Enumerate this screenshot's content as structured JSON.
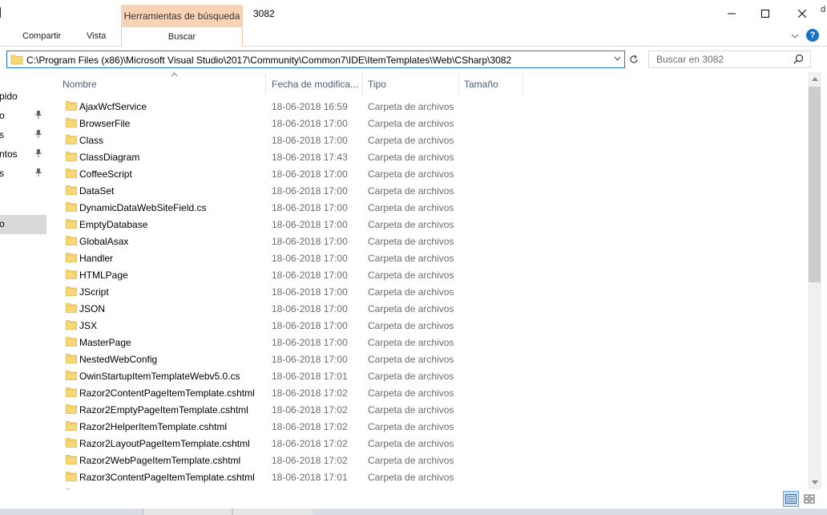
{
  "window": {
    "title": "3082",
    "contextual_tab_header": "Herramientas de búsqueda",
    "contextual_tab": "Buscar",
    "edge_letter": "d"
  },
  "ribbon": {
    "tabs": [
      {
        "label": "Compartir"
      },
      {
        "label": "Vista"
      }
    ],
    "expand_icon": "chevron-down-icon",
    "help_icon": "help-icon"
  },
  "address": {
    "path": "C:\\Program Files (x86)\\Microsoft Visual Studio\\2017\\Community\\Common7\\IDE\\ItemTemplates\\Web\\CSharp\\3082"
  },
  "search": {
    "placeholder": "Buscar en 3082"
  },
  "nav": {
    "items": [
      {
        "label": "pido",
        "pinned": false
      },
      {
        "label": "o",
        "pinned": true
      },
      {
        "label": "s",
        "pinned": true
      },
      {
        "label": "ntos",
        "pinned": true
      },
      {
        "label": "s",
        "pinned": true
      },
      {
        "label": "o",
        "pinned": false,
        "selected": true
      }
    ]
  },
  "columns": {
    "name": "Nombre",
    "date": "Fecha de modifica...",
    "type": "Tipo",
    "size": "Tamaño"
  },
  "files": [
    {
      "name": "AjaxWcfService",
      "date": "18-06-2018 16:59",
      "type": "Carpeta de archivos"
    },
    {
      "name": "BrowserFile",
      "date": "18-06-2018 17:00",
      "type": "Carpeta de archivos"
    },
    {
      "name": "Class",
      "date": "18-06-2018 17:00",
      "type": "Carpeta de archivos"
    },
    {
      "name": "ClassDiagram",
      "date": "18-06-2018 17:43",
      "type": "Carpeta de archivos"
    },
    {
      "name": "CoffeeScript",
      "date": "18-06-2018 17:00",
      "type": "Carpeta de archivos"
    },
    {
      "name": "DataSet",
      "date": "18-06-2018 17:00",
      "type": "Carpeta de archivos"
    },
    {
      "name": "DynamicDataWebSiteField.cs",
      "date": "18-06-2018 17:00",
      "type": "Carpeta de archivos"
    },
    {
      "name": "EmptyDatabase",
      "date": "18-06-2018 17:00",
      "type": "Carpeta de archivos"
    },
    {
      "name": "GlobalAsax",
      "date": "18-06-2018 17:00",
      "type": "Carpeta de archivos"
    },
    {
      "name": "Handler",
      "date": "18-06-2018 17:00",
      "type": "Carpeta de archivos"
    },
    {
      "name": "HTMLPage",
      "date": "18-06-2018 17:00",
      "type": "Carpeta de archivos"
    },
    {
      "name": "JScript",
      "date": "18-06-2018 17:00",
      "type": "Carpeta de archivos"
    },
    {
      "name": "JSON",
      "date": "18-06-2018 17:00",
      "type": "Carpeta de archivos"
    },
    {
      "name": "JSX",
      "date": "18-06-2018 17:00",
      "type": "Carpeta de archivos"
    },
    {
      "name": "MasterPage",
      "date": "18-06-2018 17:00",
      "type": "Carpeta de archivos"
    },
    {
      "name": "NestedWebConfig",
      "date": "18-06-2018 17:00",
      "type": "Carpeta de archivos"
    },
    {
      "name": "OwinStartupItemTemplateWebv5.0.cs",
      "date": "18-06-2018 17:01",
      "type": "Carpeta de archivos"
    },
    {
      "name": "Razor2ContentPageItemTemplate.cshtml",
      "date": "18-06-2018 17:02",
      "type": "Carpeta de archivos"
    },
    {
      "name": "Razor2EmptyPageItemTemplate.cshtml",
      "date": "18-06-2018 17:02",
      "type": "Carpeta de archivos"
    },
    {
      "name": "Razor2HelperItemTemplate.cshtml",
      "date": "18-06-2018 17:02",
      "type": "Carpeta de archivos"
    },
    {
      "name": "Razor2LayoutPageItemTemplate.cshtml",
      "date": "18-06-2018 17:02",
      "type": "Carpeta de archivos"
    },
    {
      "name": "Razor2WebPageItemTemplate.cshtml",
      "date": "18-06-2018 17:02",
      "type": "Carpeta de archivos"
    },
    {
      "name": "Razor3ContentPageItemTemplate.cshtml",
      "date": "18-06-2018 17:01",
      "type": "Carpeta de archivos"
    }
  ],
  "colors": {
    "folder": "#f8d775",
    "folder_dark": "#e0b74a",
    "context_tab": "#f8d3b6",
    "address_border": "#1a7bd0",
    "header_text": "#4c607a",
    "secondary_text": "#6d6d6d"
  }
}
